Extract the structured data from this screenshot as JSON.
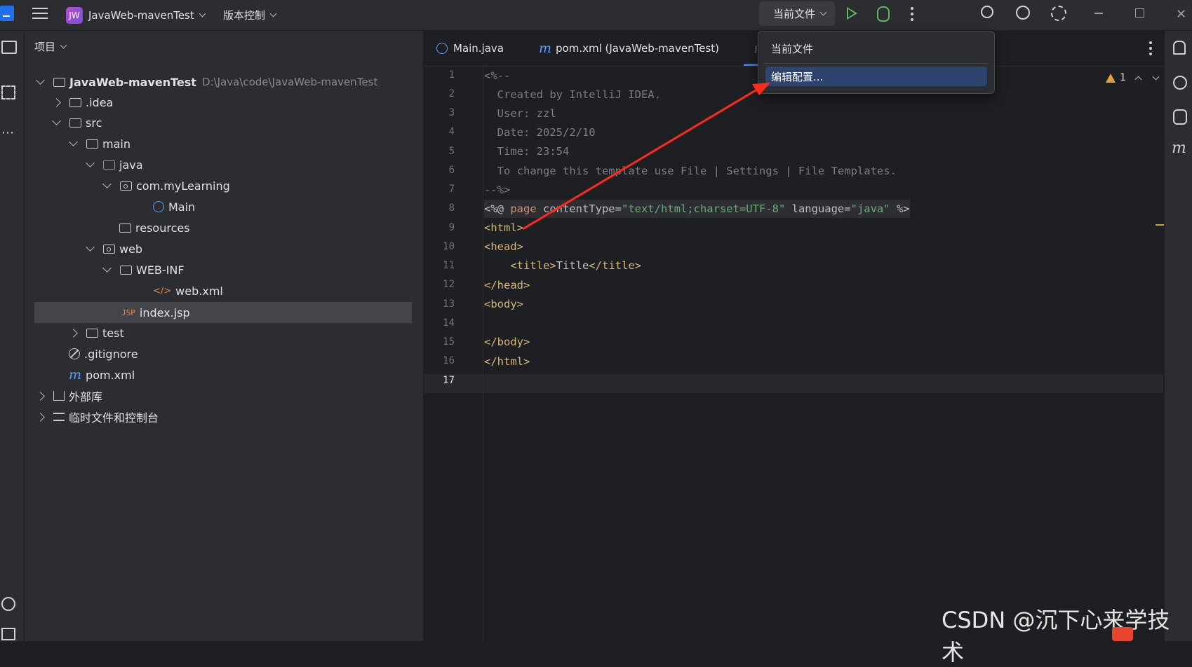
{
  "titlebar": {
    "project_badge": "JW",
    "project_name": "JavaWeb-mavenTest",
    "vcs": "版本控制",
    "run_config": "当前文件"
  },
  "project_panel": {
    "title": "项目",
    "root_name": "JavaWeb-mavenTest",
    "root_path": "D:\\Java\\code\\JavaWeb-mavenTest",
    "items": {
      "idea": ".idea",
      "src": "src",
      "main": "main",
      "java": "java",
      "pkg": "com.myLearning",
      "main_class": "Main",
      "resources": "resources",
      "web": "web",
      "webinf": "WEB-INF",
      "webxml": "web.xml",
      "indexjsp": "index.jsp",
      "test": "test",
      "gitignore": ".gitignore",
      "pom": "pom.xml",
      "extlib": "外部库",
      "scratches": "临时文件和控制台"
    },
    "selected_item": "index.jsp"
  },
  "tabs": {
    "main_java": "Main.java",
    "pom": "pom.xml (JavaWeb-mavenTest)",
    "jsp_partial": "JS"
  },
  "editor": {
    "line_numbers": [
      "1",
      "2",
      "3",
      "4",
      "5",
      "6",
      "7",
      "8",
      "9",
      "10",
      "11",
      "12",
      "13",
      "14",
      "15",
      "16",
      "17"
    ],
    "current_line": "17",
    "warnings_count": "1",
    "lines": {
      "l1": "<%--",
      "l2": "  Created by IntelliJ IDEA.",
      "l3": "  User: zzl",
      "l4": "  Date: 2025/2/10",
      "l5": "  Time: 23:54",
      "l6": "  To change this template use File | Settings | File Templates.",
      "l7": "--%>",
      "l8_open": "<%@ ",
      "l8_page": "page",
      "l8_attr1": " contentType=",
      "l8_val1": "\"text/html;charset=UTF-8\"",
      "l8_attr2": " language=",
      "l8_val2": "\"java\"",
      "l8_close": " %>",
      "l9": "<html>",
      "l10": "<head>",
      "l11_open": "    <title>",
      "l11_text": "Title",
      "l11_close": "</title>",
      "l12": "</head>",
      "l13": "<body>",
      "l15": "</body>",
      "l16": "</html>"
    }
  },
  "dropdown": {
    "header": "当前文件",
    "item": "编辑配置..."
  },
  "annotation": {
    "arrow_color": "#ff2a1a"
  },
  "watermark": "CSDN @沉下心来学技术",
  "colors": {
    "bg": "#1e1f22",
    "panel": "#2b2d30",
    "accent_blue": "#5c9eff",
    "run_green": "#5fb95f",
    "selected_menu": "#2e436e"
  }
}
